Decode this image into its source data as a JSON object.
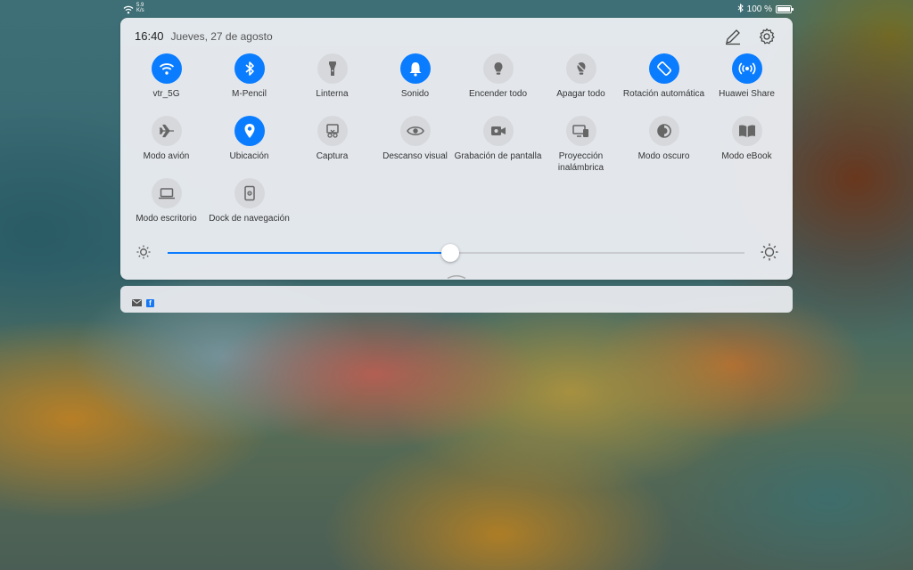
{
  "status_bar": {
    "net_speed_value": "5.9",
    "net_speed_unit": "K/s",
    "battery": "100 %"
  },
  "header": {
    "time": "16:40",
    "date": "Jueves, 27 de agosto"
  },
  "tiles": [
    {
      "label": "vtr_5G",
      "icon": "wifi-icon",
      "active": true
    },
    {
      "label": "M-Pencil",
      "icon": "bluetooth-icon",
      "active": true
    },
    {
      "label": "Linterna",
      "icon": "flashlight-icon",
      "active": false
    },
    {
      "label": "Sonido",
      "icon": "bell-icon",
      "active": true
    },
    {
      "label": "Encender todo",
      "icon": "bulb-on-icon",
      "active": false
    },
    {
      "label": "Apagar todo",
      "icon": "bulb-off-icon",
      "active": false
    },
    {
      "label": "Rotación automática",
      "icon": "rotate-icon",
      "active": true
    },
    {
      "label": "Huawei Share",
      "icon": "share-icon",
      "active": true
    },
    {
      "label": "Modo avión",
      "icon": "airplane-icon",
      "active": false
    },
    {
      "label": "Ubicación",
      "icon": "location-icon",
      "active": true
    },
    {
      "label": "Captura",
      "icon": "screenshot-icon",
      "active": false
    },
    {
      "label": "Descanso visual",
      "icon": "eye-icon",
      "active": false
    },
    {
      "label": "Grabación de pantalla",
      "icon": "record-icon",
      "active": false
    },
    {
      "label": "Proyección inalámbrica",
      "icon": "cast-icon",
      "active": false
    },
    {
      "label": "Modo oscuro",
      "icon": "dark-mode-icon",
      "active": false
    },
    {
      "label": "Modo eBook",
      "icon": "book-icon",
      "active": false
    },
    {
      "label": "Modo escritorio",
      "icon": "laptop-icon",
      "active": false
    },
    {
      "label": "Dock de navegación",
      "icon": "dock-icon",
      "active": false
    }
  ],
  "brightness": {
    "level": 0.49
  },
  "colors": {
    "accent": "#0a7cff",
    "inactive": "#d6d8dc"
  },
  "notifications": {
    "icons": [
      "mail-icon",
      "facebook-icon"
    ],
    "facebook_glyph": "f"
  }
}
